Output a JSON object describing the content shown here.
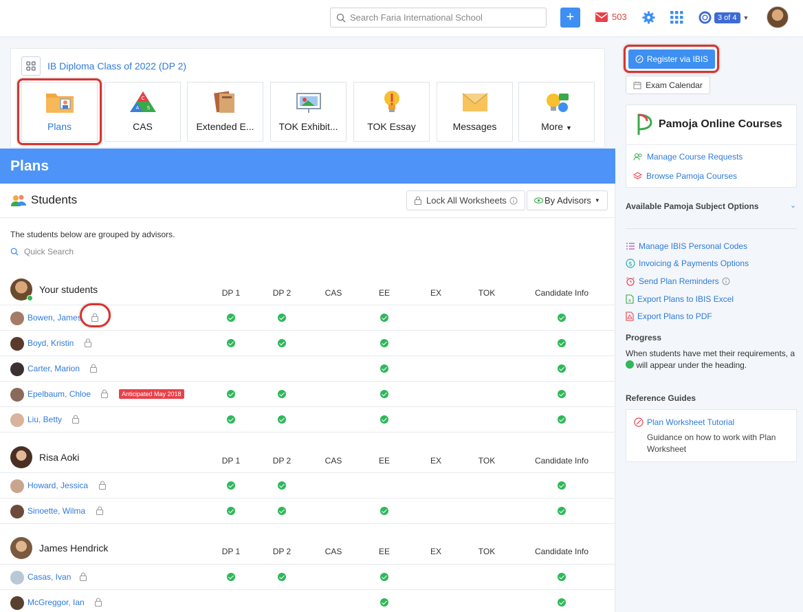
{
  "topbar": {
    "search_placeholder": "Search Faria International School",
    "plus_label": "+",
    "mail_count": "503",
    "help_badge": "3 of 4"
  },
  "class_panel": {
    "title": "IB Diploma Class of 2022 (DP 2)",
    "tiles": [
      "Plans",
      "CAS",
      "Extended E...",
      "TOK Exhibit...",
      "TOK Essay",
      "Messages",
      "More"
    ]
  },
  "plans": {
    "title": "Plans",
    "students_label": "Students",
    "lock_all_label": "Lock All Worksheets",
    "by_advisors_label": "By Advisors",
    "grouped_text": "The students below are grouped by advisors.",
    "quick_search_placeholder": "Quick Search",
    "columns": [
      "DP 1",
      "DP 2",
      "CAS",
      "EE",
      "EX",
      "TOK",
      "Candidate Info"
    ],
    "anticipated_badge": "Anticipated May 2018",
    "groups": [
      {
        "name": "Your students",
        "students": [
          {
            "name": "Bowen, James",
            "checks": [
              true,
              true,
              false,
              true,
              false,
              false,
              true
            ]
          },
          {
            "name": "Boyd, Kristin",
            "checks": [
              true,
              true,
              false,
              true,
              false,
              false,
              true
            ]
          },
          {
            "name": "Carter, Marion",
            "checks": [
              false,
              false,
              false,
              true,
              false,
              false,
              true
            ]
          },
          {
            "name": "Epelbaum, Chloe",
            "checks": [
              true,
              true,
              false,
              true,
              false,
              false,
              true
            ]
          },
          {
            "name": "Liu, Betty",
            "checks": [
              true,
              true,
              false,
              true,
              false,
              false,
              true
            ]
          }
        ]
      },
      {
        "name": "Risa Aoki",
        "students": [
          {
            "name": "Howard, Jessica",
            "checks": [
              true,
              true,
              false,
              false,
              false,
              false,
              true
            ]
          },
          {
            "name": "Sinoette, Wilma",
            "checks": [
              true,
              true,
              false,
              true,
              false,
              false,
              true
            ]
          }
        ]
      },
      {
        "name": "James Hendrick",
        "students": [
          {
            "name": "Casas, Ivan",
            "checks": [
              true,
              true,
              false,
              true,
              false,
              false,
              true
            ]
          },
          {
            "name": "McGreggor, Ian",
            "checks": [
              false,
              false,
              false,
              true,
              false,
              false,
              true
            ]
          }
        ]
      }
    ]
  },
  "sidebar": {
    "register_label": "Register via IBIS",
    "exam_calendar_label": "Exam Calendar",
    "pamoja_title": "Pamoja Online Courses",
    "manage_requests": "Manage Course Requests",
    "browse_courses": "Browse Pamoja Courses",
    "available_options": "Available Pamoja Subject Options",
    "links": [
      "Manage IBIS Personal Codes",
      "Invoicing & Payments Options",
      "Send Plan Reminders",
      "Export Plans to IBIS Excel",
      "Export Plans to PDF"
    ],
    "progress_heading": "Progress",
    "progress_text_before": "When students have met their requirements, a",
    "progress_text_after": "will appear under the heading.",
    "reference_heading": "Reference Guides",
    "guide_title": "Plan Worksheet Tutorial",
    "guide_desc": "Guidance on how to work with Plan Worksheet"
  },
  "colors": {
    "accent": "#3d8ff2",
    "header_blue": "#4d93f8",
    "link": "#2f7bd8",
    "check": "#2fb85a",
    "highlight": "#d9332c"
  }
}
